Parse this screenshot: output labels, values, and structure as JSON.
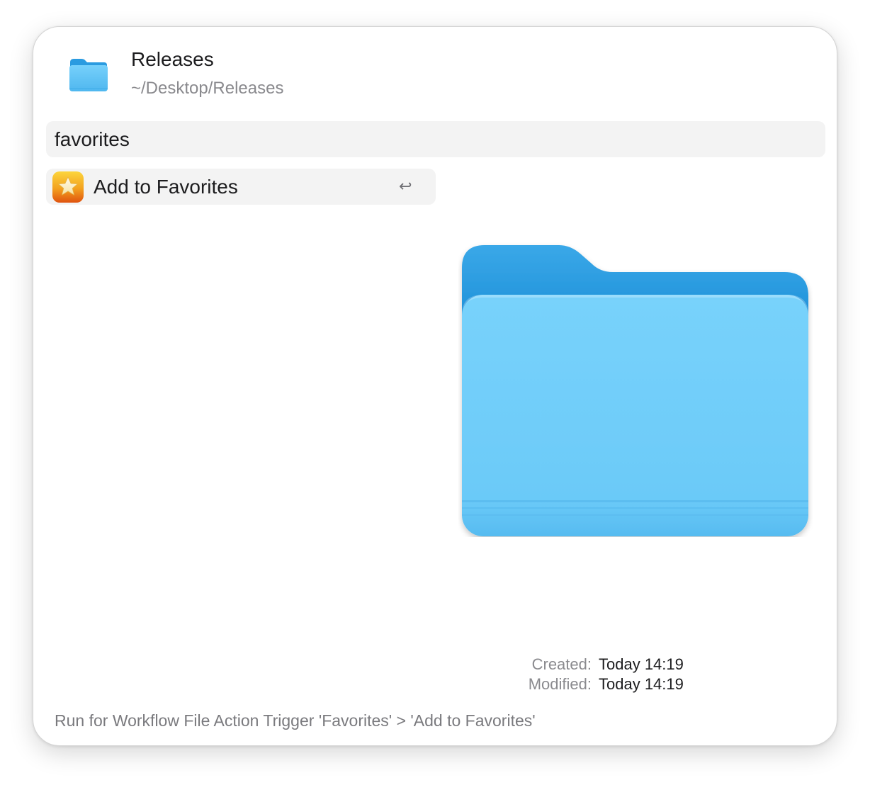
{
  "header": {
    "title": "Releases",
    "path": "~/Desktop/Releases",
    "icon": "folder-icon"
  },
  "search": {
    "value": "favorites"
  },
  "results": [
    {
      "label": "Add to Favorites",
      "icon": "star-icon",
      "shortcut": "↩"
    }
  ],
  "preview": {
    "icon": "folder-icon",
    "meta": [
      {
        "key": "Created:",
        "value": "Today 14:19"
      },
      {
        "key": "Modified:",
        "value": "Today 14:19"
      }
    ]
  },
  "footer": {
    "text": "Run for Workflow File Action Trigger 'Favorites' > 'Add to Favorites'"
  },
  "colors": {
    "folder_front": "#6ccbf9",
    "folder_back": "#1f95db",
    "star_badge_top": "#fcd53d",
    "star_badge_bottom": "#e0530f"
  }
}
